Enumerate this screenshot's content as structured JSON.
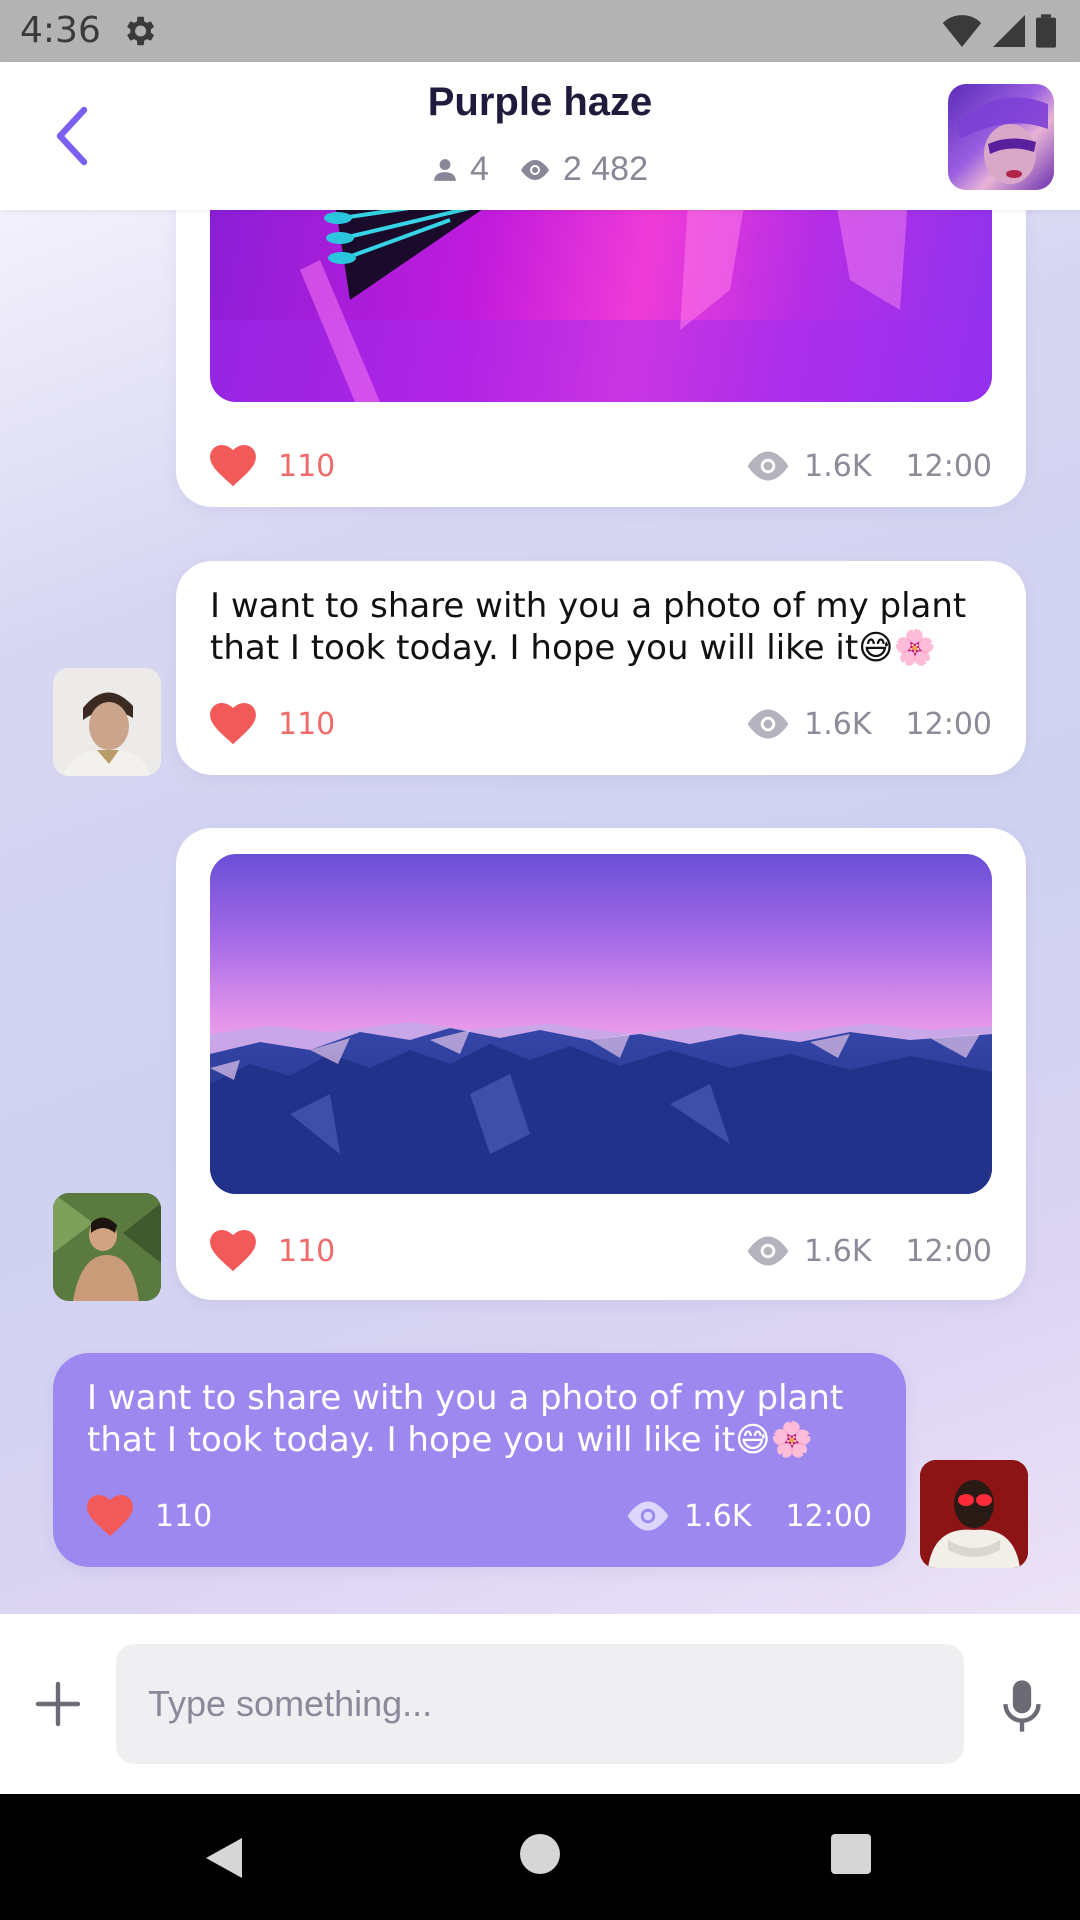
{
  "status_bar": {
    "time": "4:36"
  },
  "header": {
    "title": "Purple haze",
    "members": "4",
    "views": "2 482"
  },
  "messages": [
    {
      "likes": "110",
      "views": "1.6K",
      "time": "12:00"
    },
    {
      "text": "I want to share with you a photo of my plant that I took today. I hope you will like it😅🌸",
      "likes": "110",
      "views": "1.6K",
      "time": "12:00"
    },
    {
      "likes": "110",
      "views": "1.6K",
      "time": "12:00"
    },
    {
      "text": "I want to share with you a photo of my plant that I took today. I hope you will like it😅🌸",
      "likes": "110",
      "views": "1.6K",
      "time": "12:00"
    }
  ],
  "input": {
    "placeholder": "Type something..."
  },
  "colors": {
    "accent": "#9c88ef",
    "like": "#f06a6a",
    "back": "#7b5ff0"
  },
  "icons": [
    "settings-gear",
    "wifi",
    "signal",
    "battery",
    "back-arrow",
    "person",
    "eye",
    "heart",
    "plus",
    "microphone",
    "nav-back",
    "nav-home",
    "nav-recents"
  ]
}
